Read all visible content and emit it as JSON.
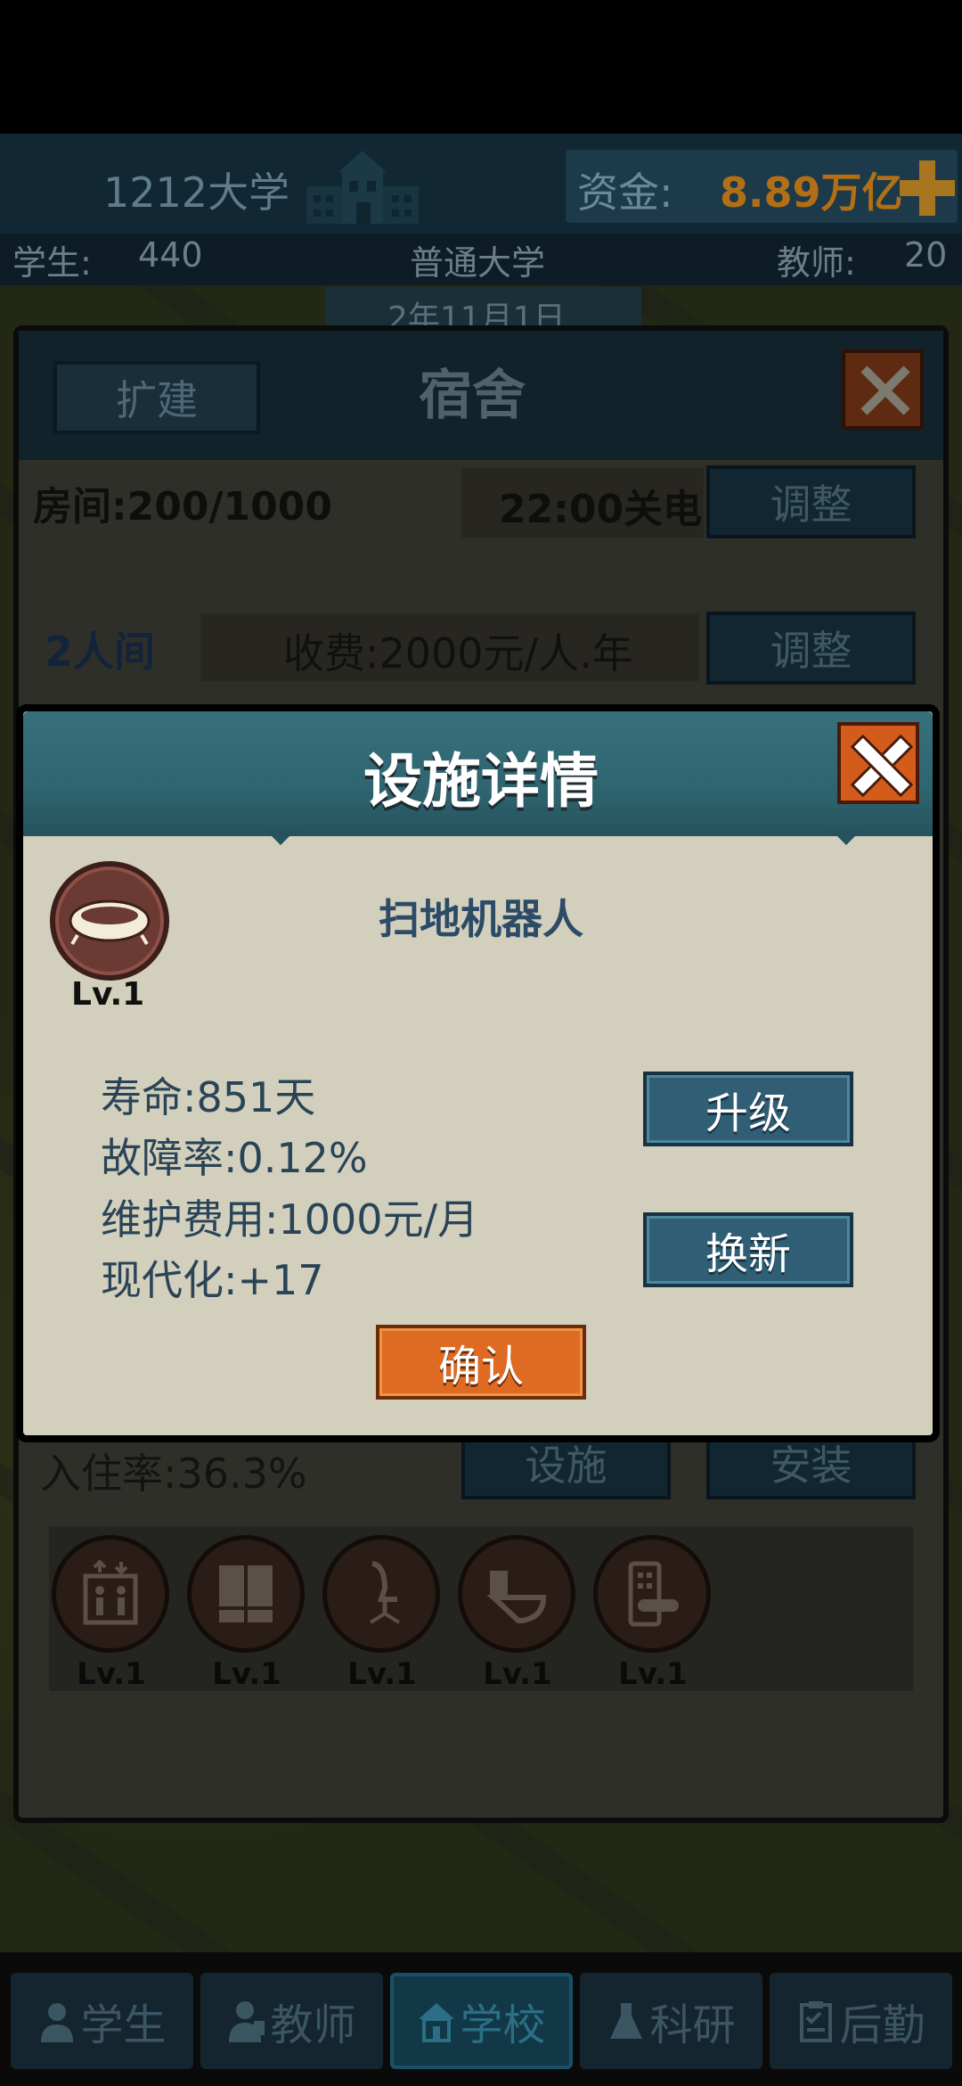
{
  "hud": {
    "university_name": "1212大学",
    "money_label": "资金:",
    "money_value": "8.89万亿",
    "students_label": "学生:",
    "students_value": "440",
    "university_type": "普通大学",
    "teachers_label": "教师:",
    "teachers_value": "20",
    "date": "2年11月1日"
  },
  "dorm": {
    "title": "宿舍",
    "expand_label": "扩建",
    "rooms_label": "房间:200/1000",
    "power_off_label": "22:00关电",
    "adjust_label": "调整",
    "room_type": "2人间",
    "fee_label": "收费:2000元/人.年",
    "occupancy_label": "入住率:36.3%",
    "facility_label": "设施",
    "install_label": "安装",
    "facilities": [
      {
        "icon": "elevator-icon",
        "level": "Lv.1"
      },
      {
        "icon": "wardrobe-icon",
        "level": "Lv.1"
      },
      {
        "icon": "office-chair-icon",
        "level": "Lv.1"
      },
      {
        "icon": "toilet-icon",
        "level": "Lv.1"
      },
      {
        "icon": "smart-lock-icon",
        "level": "Lv.1"
      }
    ]
  },
  "modal": {
    "title": "设施详情",
    "facility_name": "扫地机器人",
    "level": "Lv.1",
    "lifespan": "寿命:851天",
    "failure_rate": "故障率:0.12%",
    "maintenance_cost": "维护费用:1000元/月",
    "modernization": "现代化:+17",
    "upgrade_label": "升级",
    "renew_label": "换新",
    "confirm_label": "确认"
  },
  "nav": {
    "tabs": [
      {
        "label": "学生",
        "icon": "student-icon"
      },
      {
        "label": "教师",
        "icon": "teacher-icon"
      },
      {
        "label": "学校",
        "icon": "school-icon"
      },
      {
        "label": "科研",
        "icon": "flask-icon"
      },
      {
        "label": "后勤",
        "icon": "clipboard-icon"
      }
    ],
    "active_index": 2
  },
  "colors": {
    "modal_header": "#2f6570",
    "confirm_orange": "#de6b21",
    "action_blue": "#305f75",
    "money_gold": "#b26f16"
  }
}
